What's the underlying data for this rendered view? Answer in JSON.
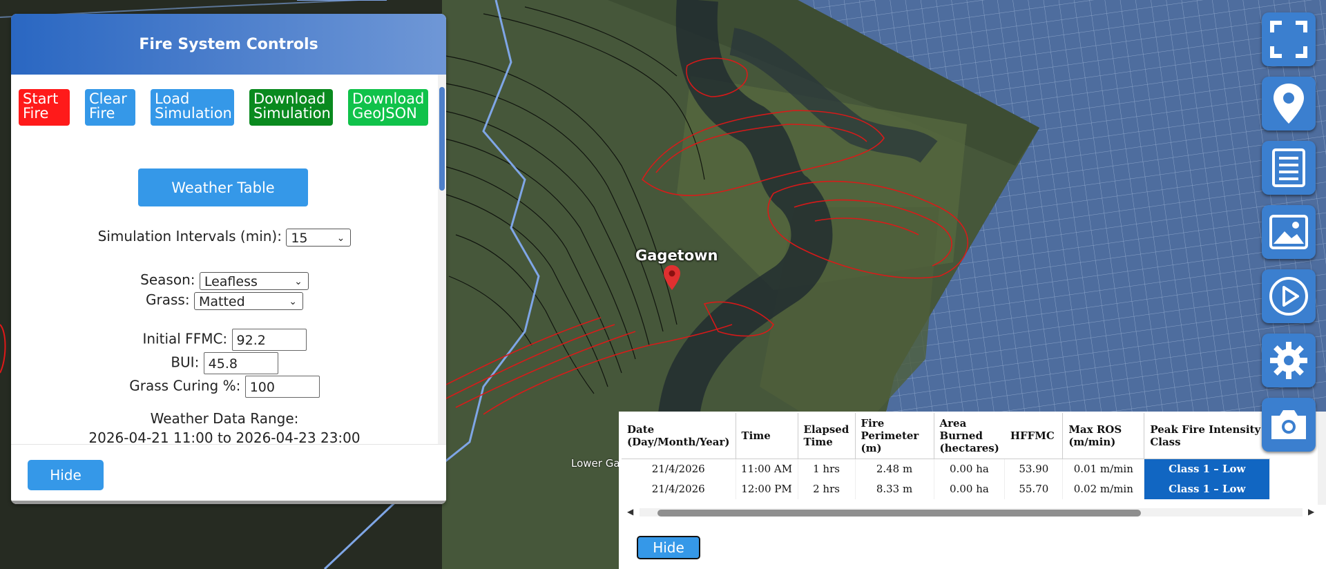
{
  "map": {
    "place_label": "Gagetown",
    "lower_label": "Lower Ga"
  },
  "controls": {
    "title": "Fire System Controls",
    "buttons": {
      "start_fire": "Start Fire",
      "clear_fire": "Clear Fire",
      "load_simulation": "Load Simulation",
      "download_simulation": "Download Simulation",
      "download_geojson": "Download GeoJSON"
    },
    "weather_table_label": "Weather Table",
    "interval_label": "Simulation Intervals (min):",
    "interval_value": "15",
    "season_label": "Season:",
    "season_value": "Leafless",
    "grass_label": "Grass:",
    "grass_value": "Matted",
    "ffmc_label": "Initial FFMC:",
    "ffmc_value": "92.2",
    "bui_label": "BUI:",
    "bui_value": "45.8",
    "curing_label": "Grass Curing %:",
    "curing_value": "100",
    "range_label": "Weather Data Range:",
    "range_value": "2026-04-21 11:00 to 2026-04-23 23:00",
    "hide_label": "Hide"
  },
  "results": {
    "headers": [
      "Date (Day/Month/Year)",
      "Time",
      "Elapsed Time",
      "Fire Perimeter (m)",
      "Area Burned (hectares)",
      "HFFMC",
      "Max ROS (m/min)",
      "Peak Fire Intensity Class"
    ],
    "rows": [
      [
        "21/4/2026",
        "11:00 AM",
        "1 hrs",
        "2.48 m",
        "0.00 ha",
        "53.90",
        "0.01 m/min",
        "Class 1 – Low"
      ],
      [
        "21/4/2026",
        "12:00 PM",
        "2 hrs",
        "8.33 m",
        "0.00 ha",
        "55.70",
        "0.02 m/min",
        "Class 1 – Low"
      ]
    ],
    "hide_label": "Hide"
  },
  "toolbar": {
    "icons": [
      "fullscreen-icon",
      "location-pin-icon",
      "document-icon",
      "image-icon",
      "play-icon",
      "gear-icon",
      "camera-icon"
    ]
  },
  "colors": {
    "panel_header": "#2a67c2",
    "button_blue": "#3598e8",
    "button_red": "#ff1a1a",
    "button_dark_green": "#0a8a1f",
    "button_green": "#10c24a",
    "class_low": "#1166c2",
    "fire_perimeter": "#e01818"
  }
}
